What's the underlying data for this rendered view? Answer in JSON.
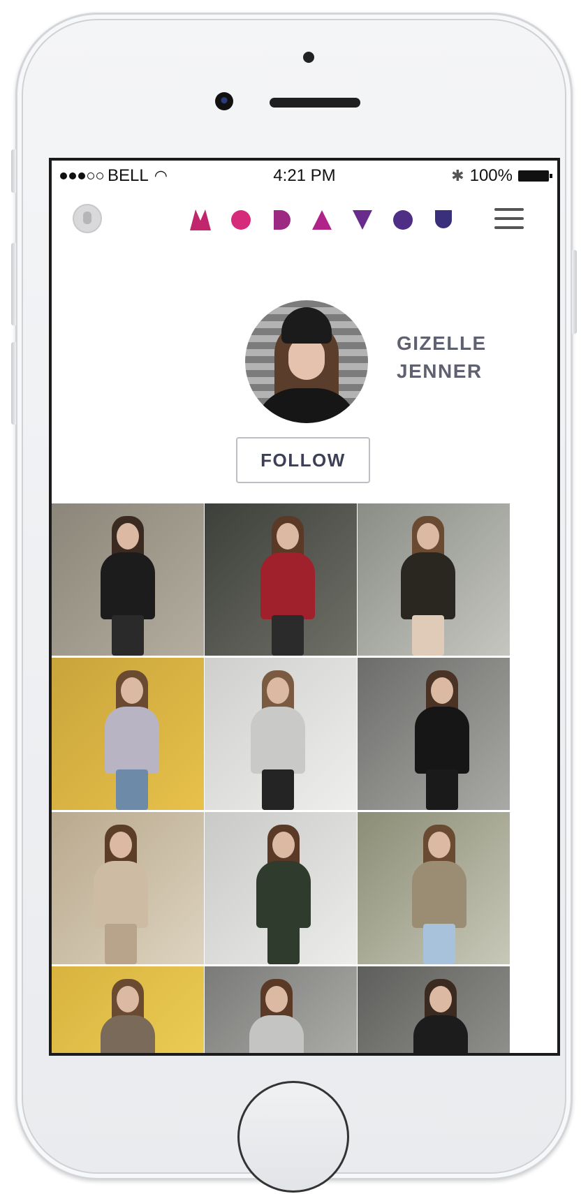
{
  "status_bar": {
    "carrier": "BELL",
    "time": "4:21 PM",
    "battery": "100%"
  },
  "app": {
    "logo_alt": "MODAVOU",
    "logo_colors": [
      "#c1266d",
      "#d62a7a",
      "#9c2a83",
      "#b0248a",
      "#6a2c8c",
      "#4f2f85",
      "#3a2f7a"
    ]
  },
  "profile": {
    "name_line1": "GIZELLE",
    "name_line2": "JENNER",
    "follow_label": "FOLLOW"
  },
  "grid": {
    "tiles": [
      {
        "bg": [
          "#8b8679",
          "#b4ada0"
        ],
        "hair": "#3b2a20",
        "body": "#1c1c1c",
        "legs": "#2a2a2a"
      },
      {
        "bg": [
          "#3d3f3a",
          "#6f7168"
        ],
        "hair": "#5a3a26",
        "body": "#a0212c",
        "legs": "#2b2b2b"
      },
      {
        "bg": [
          "#8a8d86",
          "#c5c6c0"
        ],
        "hair": "#6a4a30",
        "body": "#2a2620",
        "legs": "#e0cbb8"
      },
      {
        "bg": [
          "#c9a43b",
          "#e7c14a"
        ],
        "hair": "#6a4a30",
        "body": "#b8b4c4",
        "legs": "#6d8aa8"
      },
      {
        "bg": [
          "#cfcfcd",
          "#eeeeec"
        ],
        "hair": "#7a5a40",
        "body": "#c9c9c7",
        "legs": "#242424"
      },
      {
        "bg": [
          "#6c6c6a",
          "#a9a9a6"
        ],
        "hair": "#4a3324",
        "body": "#161616",
        "legs": "#1a1a1a"
      },
      {
        "bg": [
          "#b9a98e",
          "#ddd3bf"
        ],
        "hair": "#5c3d28",
        "body": "#cdbba4",
        "legs": "#b8a48a"
      },
      {
        "bg": [
          "#c9cac8",
          "#ecedeb"
        ],
        "hair": "#5a3a26",
        "body": "#2f3b2c",
        "legs": "#2f3b2c"
      },
      {
        "bg": [
          "#8c8d76",
          "#c7c8b8"
        ],
        "hair": "#6a4a30",
        "body": "#9b8c74",
        "legs": "#a8c2dc"
      },
      {
        "bg": [
          "#d8b33f",
          "#f0d25a"
        ],
        "hair": "#6a4a30",
        "body": "#7a6a5a",
        "legs": "#5a5a5a"
      },
      {
        "bg": [
          "#7a7a78",
          "#b8b8b5"
        ],
        "hair": "#5a3a26",
        "body": "#c4c4c2",
        "legs": "#3a3a3a"
      },
      {
        "bg": [
          "#5e5e5c",
          "#9c9c98"
        ],
        "hair": "#3b2a20",
        "body": "#1c1c1c",
        "legs": "#1c1c1c"
      }
    ]
  }
}
